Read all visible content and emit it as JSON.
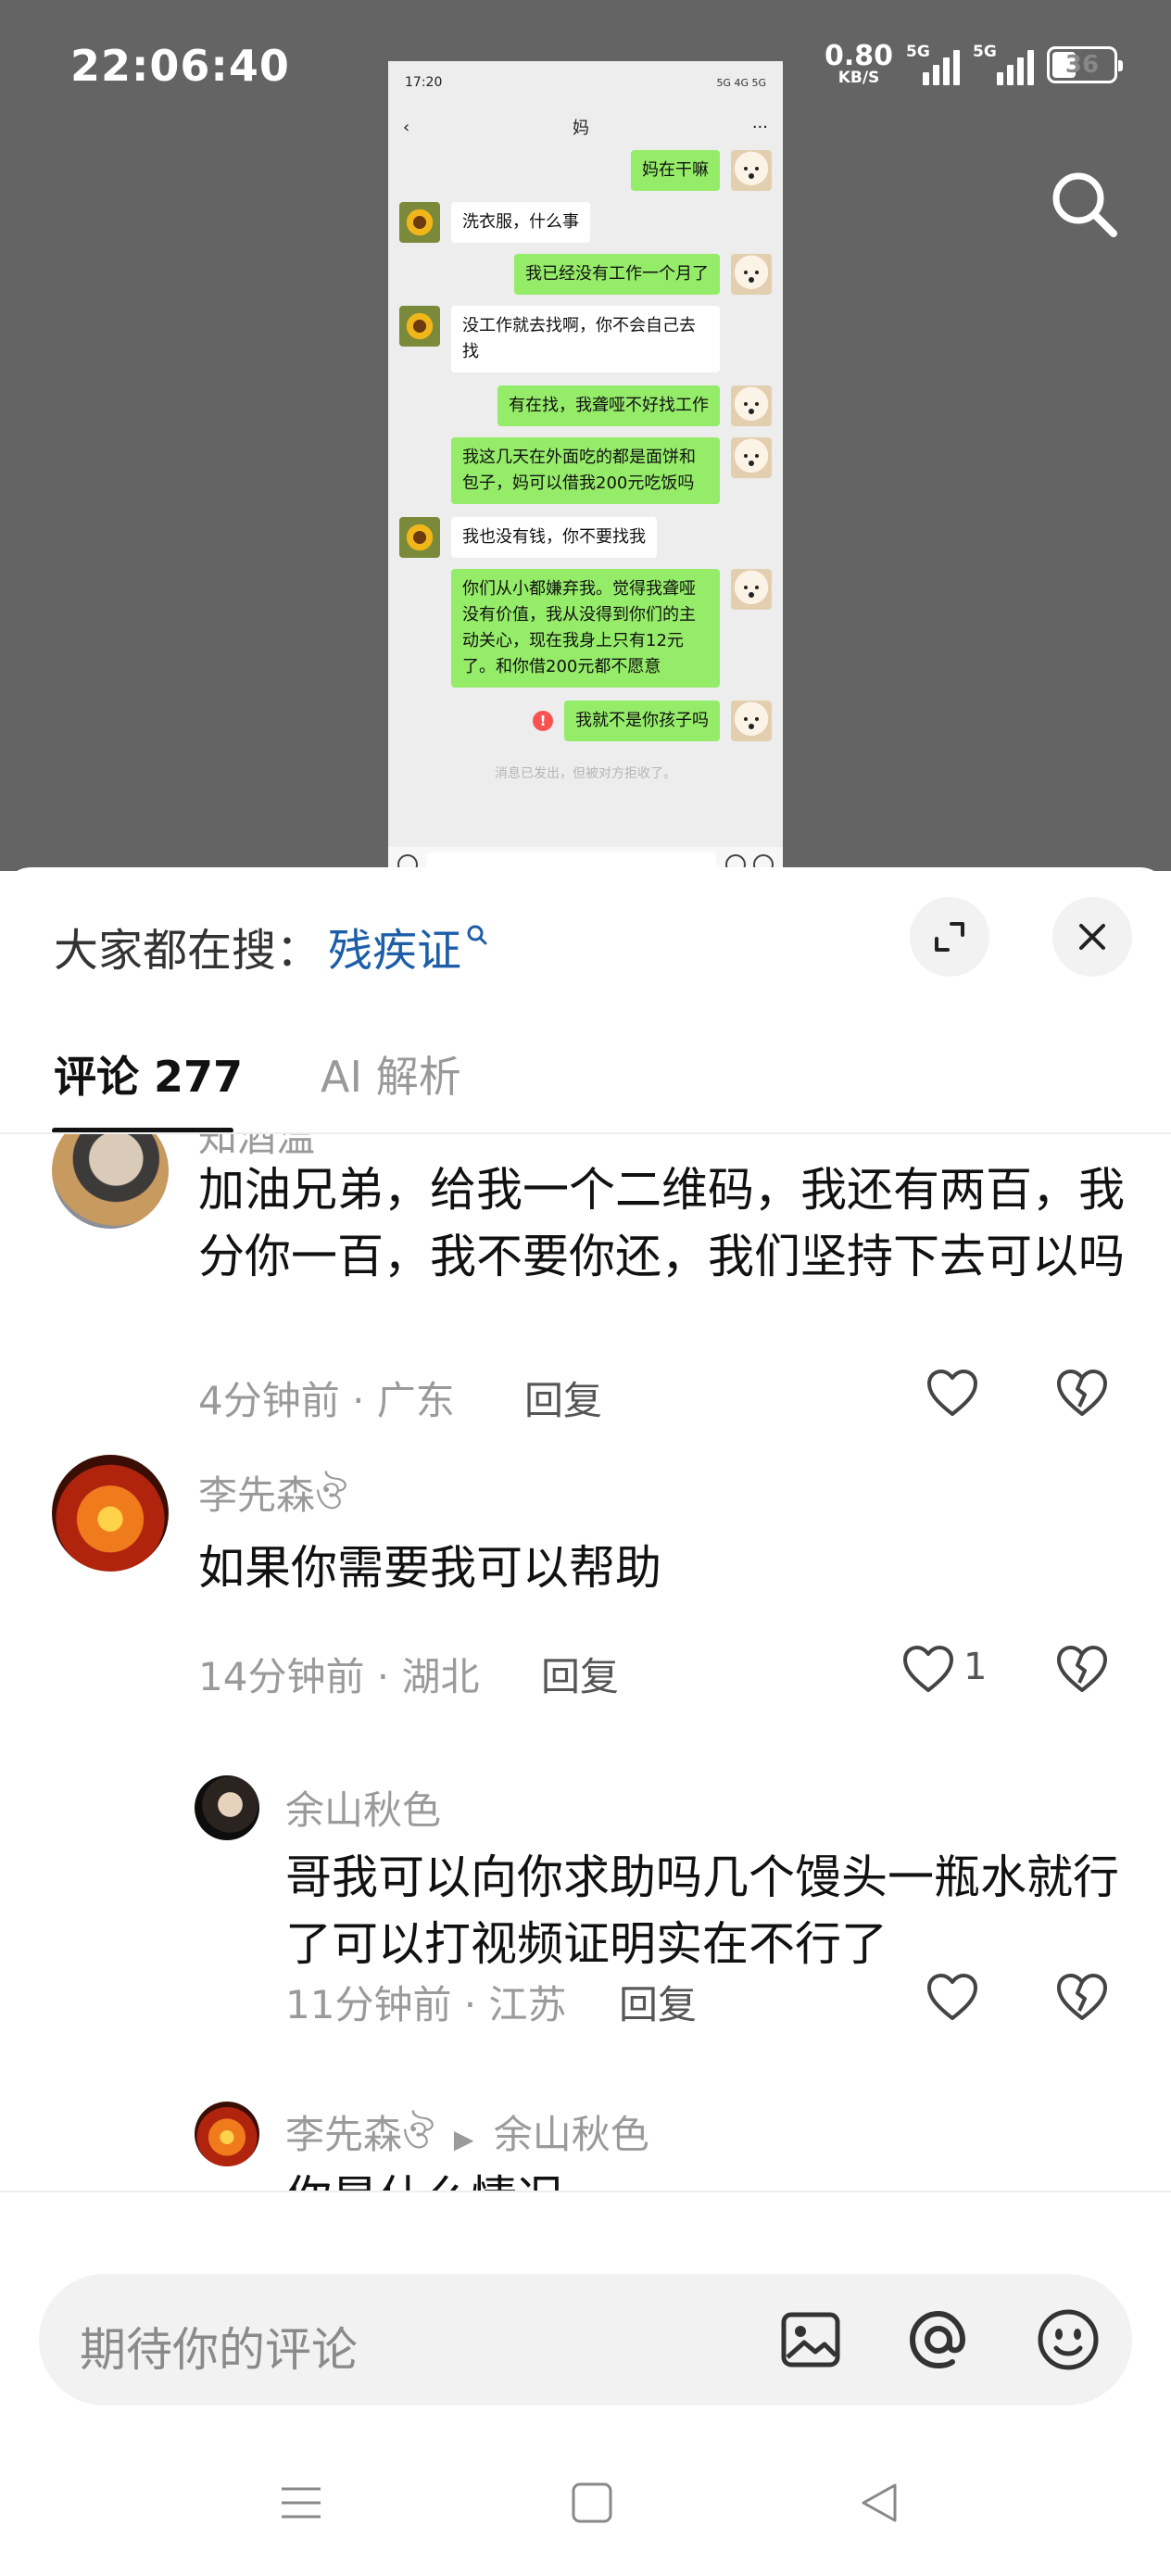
{
  "status_bar": {
    "time": "22:06:40",
    "net_speed": "0.80",
    "net_unit": "KB/S",
    "signal1_tag": "5G",
    "signal2_tag": "5G",
    "battery_level": "36"
  },
  "chat_screenshot": {
    "status_time": "17:20",
    "status_icons": "5G 4G 5G",
    "title": "妈",
    "more": "···",
    "messages": [
      {
        "side": "right",
        "text": "妈在干嘛"
      },
      {
        "side": "left",
        "text": "洗衣服，什么事"
      },
      {
        "side": "right",
        "text": "我已经没有工作一个月了"
      },
      {
        "side": "left",
        "text": "没工作就去找啊，你不会自己去找"
      },
      {
        "side": "right",
        "text": "有在找，我聋哑不好找工作"
      },
      {
        "side": "right",
        "text": "我这几天在外面吃的都是面饼和包子，妈可以借我200元吃饭吗"
      },
      {
        "side": "left",
        "text": "我也没有钱，你不要找我"
      },
      {
        "side": "right",
        "text": "你们从小都嫌弃我。觉得我聋哑没有价值，我从没得到你们的主动关心，现在我身上只有12元了。和你借200元都不愿意"
      },
      {
        "side": "right",
        "text": "我就不是你孩子吗",
        "error": "!"
      }
    ],
    "system_note": "消息已发出，但被对方拒收了。"
  },
  "sheet": {
    "hot_search_label": "大家都在搜：",
    "hot_search_keyword": "残疾证",
    "tabs": [
      {
        "label": "评论 277",
        "active": true
      },
      {
        "label": "AI 解析",
        "active": false
      }
    ]
  },
  "comments": [
    {
      "name": "知酒温",
      "text": "加油兄弟，给我一个二维码，我还有两百，我分你一百，我不要你还，我们坚持下去可以吗",
      "meta": "4分钟前 · 广东",
      "reply": "回复",
      "likes": ""
    },
    {
      "name": "李先森ঔ",
      "text": "如果你需要我可以帮助",
      "meta": "14分钟前 · 湖北",
      "reply": "回复",
      "likes": "1"
    },
    {
      "name": "余山秋色",
      "text": "哥我可以向你求助吗几个馒头一瓶水就行了可以打视频证明实在不行了",
      "meta": "11分钟前 · 江苏",
      "reply": "回复",
      "likes": ""
    },
    {
      "name": "李先森ঔ",
      "reply_to": "余山秋色",
      "text": "你是什么情况"
    }
  ],
  "input": {
    "placeholder": "期待你的评论"
  },
  "icons": {
    "search": "search-icon",
    "expand": "expand-icon",
    "close": "close-icon",
    "like": "heart-icon",
    "unlike": "broken-heart-icon",
    "image": "image-icon",
    "mention": "at-icon",
    "emoji": "emoji-icon"
  }
}
